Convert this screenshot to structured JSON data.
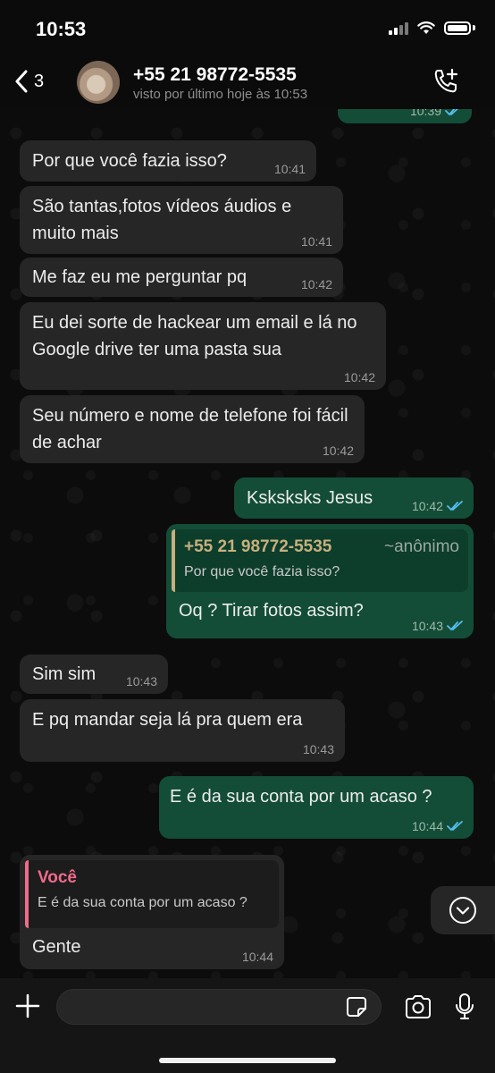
{
  "status_bar": {
    "time": "10:53",
    "battery_level": 1.0
  },
  "header": {
    "back_count": "3",
    "contact_name": "+55 21 98772-5535",
    "last_seen": "visto por último hoje às 10:53"
  },
  "messages": [
    {
      "direction": "out",
      "time": "10:39",
      "status": "read"
    },
    {
      "direction": "in",
      "text": "Por que você fazia isso?",
      "time": "10:41"
    },
    {
      "direction": "in",
      "text": "São tantas,fotos vídeos áudios e muito mais",
      "time": "10:41"
    },
    {
      "direction": "in",
      "text": "Me faz eu me perguntar pq",
      "time": "10:42"
    },
    {
      "direction": "in",
      "text": "Eu dei sorte de hackear um email e lá no Google drive ter uma pasta sua",
      "time": "10:42"
    },
    {
      "direction": "in",
      "text": "Seu número e nome de telefone foi fácil de achar",
      "time": "10:42"
    },
    {
      "direction": "out",
      "text": "Ksksksks Jesus",
      "time": "10:42",
      "status": "read"
    },
    {
      "direction": "out",
      "quote": {
        "author": "+55 21 98772-5535",
        "alias": "~anônimo",
        "text": "Por que você fazia isso?"
      },
      "text": "Oq ? Tirar fotos assim?",
      "time": "10:43",
      "status": "read"
    },
    {
      "direction": "in",
      "text": "Sim sim",
      "time": "10:43"
    },
    {
      "direction": "in",
      "text": "E pq mandar seja lá pra quem era",
      "time": "10:43"
    },
    {
      "direction": "out",
      "text": "E é da sua conta por um acaso ?",
      "time": "10:44",
      "status": "read"
    },
    {
      "direction": "in",
      "quote": {
        "author": "Você",
        "text": "E é da sua conta por um acaso ?"
      },
      "text": "Gente",
      "time": "10:44"
    }
  ],
  "composer": {
    "placeholder": ""
  },
  "icons": {
    "back": "chevron-left-icon",
    "call": "phone-plus-icon",
    "scroll": "chevron-down-circle-icon",
    "attach": "plus-icon",
    "sticker": "sticker-icon",
    "camera": "camera-icon",
    "mic": "microphone-icon"
  },
  "colors": {
    "incoming_bubble": "#262626",
    "outgoing_bubble": "#134d37",
    "read_ticks": "#53bdeb",
    "quote_author_contact": "#c7b07e",
    "quote_author_self": "#f06a8b"
  }
}
